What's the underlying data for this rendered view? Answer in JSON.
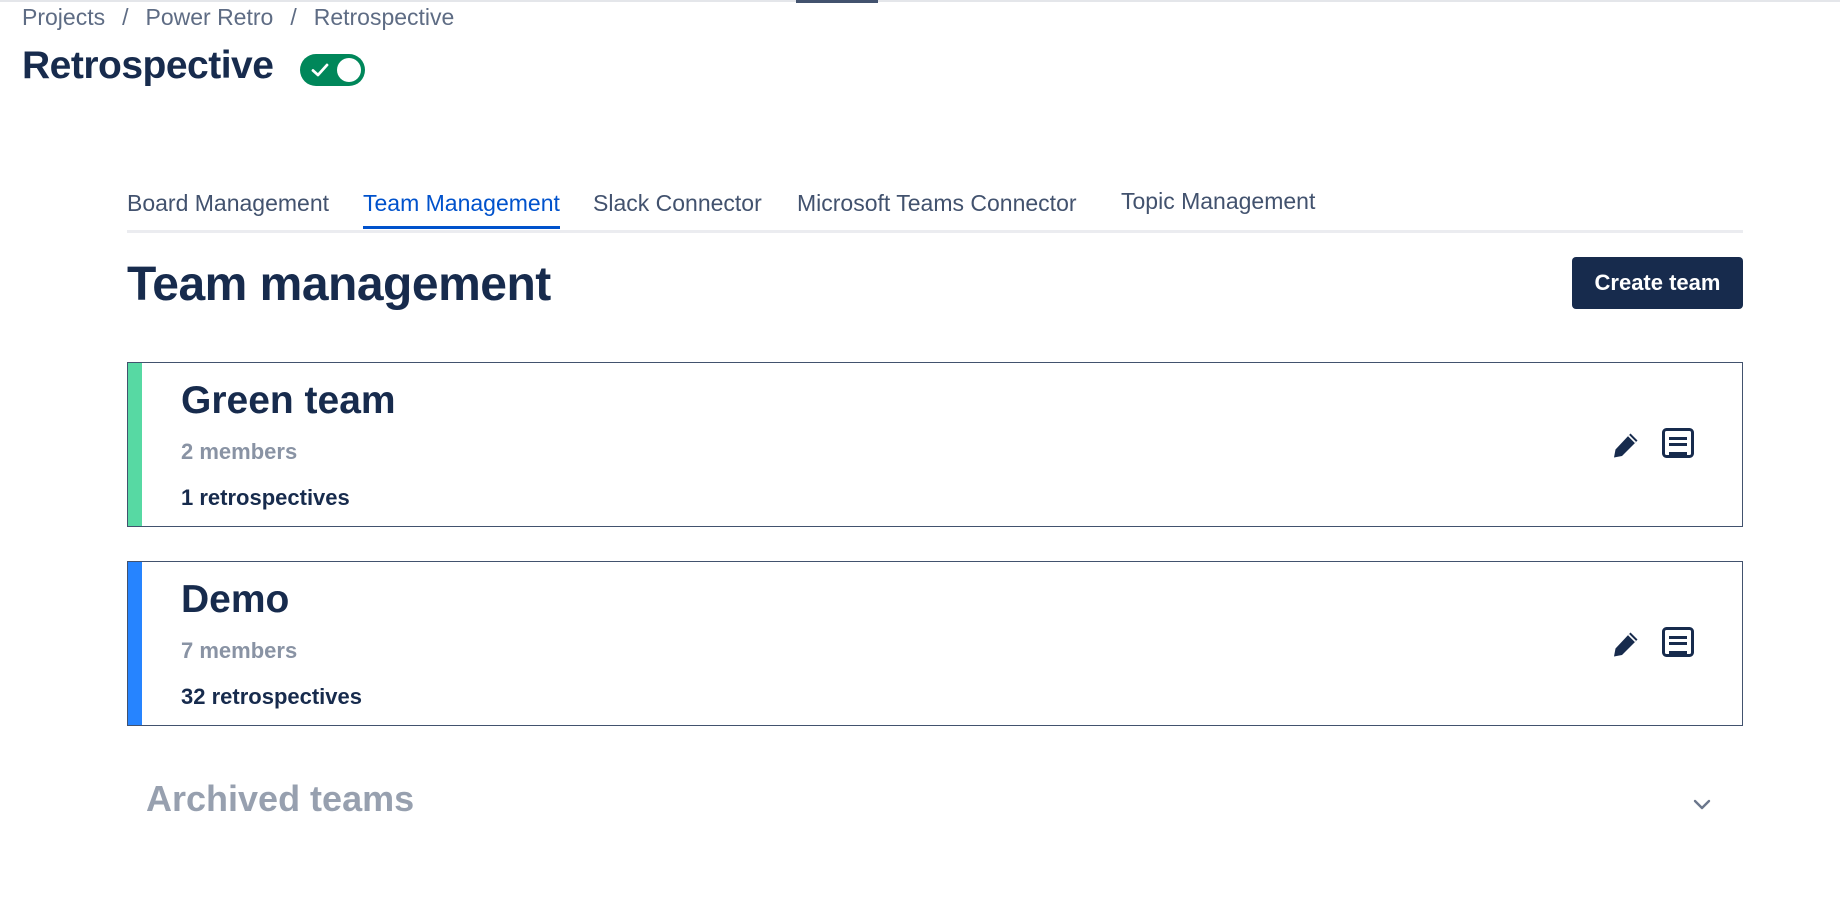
{
  "breadcrumb": {
    "items": [
      "Projects",
      "Power Retro",
      "Retrospective"
    ],
    "separator": "/"
  },
  "header": {
    "title": "Retrospective",
    "toggle_on": true,
    "toggle_color": "#00875a"
  },
  "tabs": [
    {
      "label": "Board Management",
      "active": false
    },
    {
      "label": "Team Management",
      "active": true
    },
    {
      "label": "Slack Connector",
      "active": false
    },
    {
      "label": "Microsoft Teams Connector",
      "active": false
    },
    {
      "label": "Topic Management",
      "active": false
    }
  ],
  "main": {
    "title": "Team management",
    "create_button_label": "Create team"
  },
  "teams": [
    {
      "name": "Green team",
      "members": "2 members",
      "retrospectives": "1 retrospectives",
      "color": "#57d9a3"
    },
    {
      "name": "Demo",
      "members": "7 members",
      "retrospectives": "32 retrospectives",
      "color": "#2684ff"
    }
  ],
  "archived": {
    "title": "Archived teams",
    "icon": "chevron-down-icon"
  },
  "icons": {
    "edit": "pencil-icon",
    "notes": "notes-icon"
  }
}
